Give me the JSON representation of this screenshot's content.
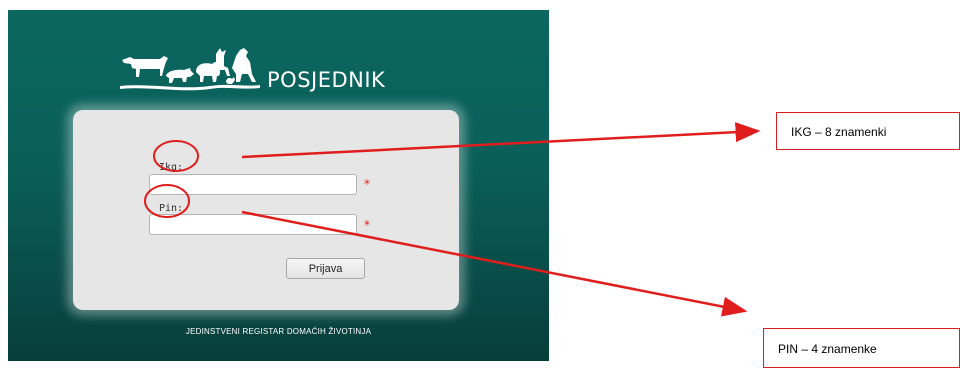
{
  "app": {
    "brand": "POSJEDNIK",
    "logo_icon": "livestock-silhouette-logo-icon",
    "footer": "JEDINSTVENI REGISTAR DOMAĆIH ŽIVOTINJA"
  },
  "form": {
    "ikg_label": "Ikg:",
    "ikg_value": "",
    "pin_label": "Pin:",
    "pin_value": "",
    "required_mark": "*",
    "submit_label": "Prijava"
  },
  "annotations": {
    "ikg_note": "IKG – 8 znamenki",
    "pin_note": "PIN – 4 znamenke",
    "color": "#e01e1e"
  },
  "theme": {
    "panel_color": "#0a5e58",
    "form_bg": "#e6e6e6"
  }
}
